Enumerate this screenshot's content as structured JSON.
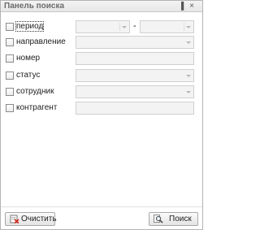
{
  "panel": {
    "title": "Панель поиска",
    "pin_icon": "pin-icon",
    "close_icon": "close-icon"
  },
  "filters": [
    {
      "label": "период",
      "checked": false
    },
    {
      "label": "направление",
      "checked": false
    },
    {
      "label": "номер",
      "checked": false
    },
    {
      "label": "статус",
      "checked": false
    },
    {
      "label": "сотрудник",
      "checked": false
    },
    {
      "label": "контрагент",
      "checked": false
    }
  ],
  "period": {
    "separator": "-",
    "from_value": "",
    "to_value": ""
  },
  "fields": {
    "direction_value": "",
    "number_value": "",
    "status_value": "",
    "employee_value": "",
    "counterparty_value": ""
  },
  "buttons": {
    "clear_label": "Очистить",
    "clear_icon": "clear-filter-icon",
    "search_label": "Поиск",
    "search_icon": "search-icon"
  },
  "colors": {
    "border": "#b4b4b4",
    "field_bg": "#f3f3f3",
    "title_text": "#6a6a6a",
    "clear_icon_red": "#d42a1a"
  }
}
